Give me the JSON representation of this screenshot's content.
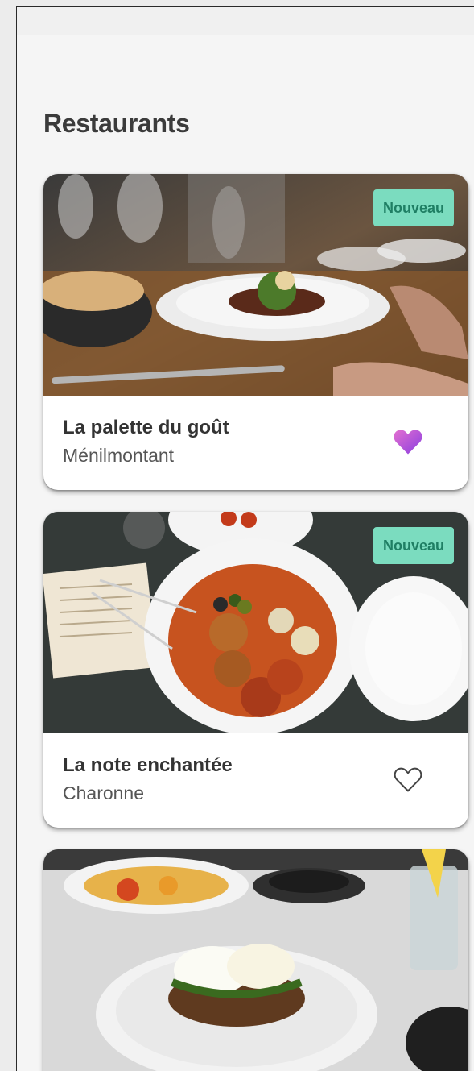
{
  "page": {
    "title": "Restaurants"
  },
  "restaurants": [
    {
      "name": "La palette du goût",
      "area": "Ménilmontant",
      "badge": "Nouveau",
      "favorite": true,
      "image_icon": "plated-dish-photo"
    },
    {
      "name": "La note enchantée",
      "area": "Charonne",
      "badge": "Nouveau",
      "favorite": false,
      "image_icon": "meatballs-dish-photo"
    },
    {
      "name": "",
      "area": "",
      "badge": "",
      "favorite": false,
      "image_icon": "eggs-benedict-photo"
    }
  ],
  "colors": {
    "badge_bg": "#7bdcbf",
    "badge_text": "#1f7f64",
    "favorite_gradient_start": "#e36fd0",
    "favorite_gradient_end": "#8a3fe0"
  }
}
